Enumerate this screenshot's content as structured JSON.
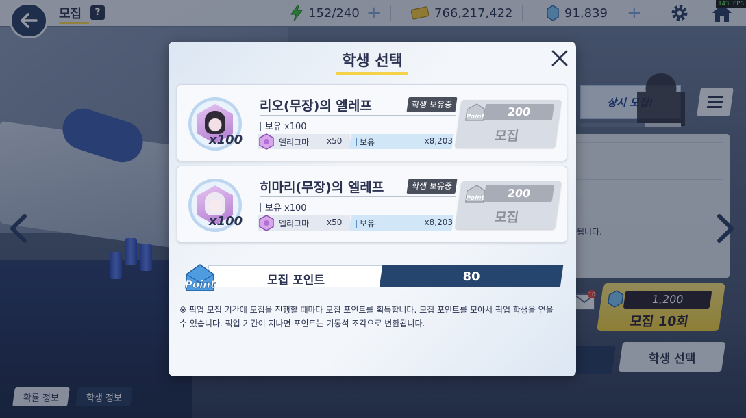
{
  "topbar": {
    "title": "모집",
    "help_label": "?",
    "ap": "152/240",
    "credits": "766,217,422",
    "pyroxene": "91,839",
    "fps": "143 FPS"
  },
  "right_panel": {
    "banner_text": "상시 모집!",
    "note_text": "됩니다.",
    "recruit10_cost": "1,200",
    "recruit10_label": "모집 10회",
    "mail_badge": "10",
    "student_select_label": "학생 선택"
  },
  "bottom_tabs": {
    "rates_label": "확률 정보",
    "student_info_label": "학생 정보"
  },
  "modal": {
    "title": "학생 선택",
    "cards": [
      {
        "name": "리오(무장)의 엘레프",
        "badge": "학생 보유중",
        "portrait_qty": "x100",
        "owned_count": "보유 x100",
        "eleph_name": "엘리그마",
        "eleph_cost": "x50",
        "eleph_owned_label": "보유",
        "eleph_owned_value": "x8,203",
        "point_cost": "200",
        "recruit_label": "모집"
      },
      {
        "name": "히마리(무장)의 엘레프",
        "badge": "학생 보유중",
        "portrait_qty": "x100",
        "owned_count": "보유 x100",
        "eleph_name": "엘리그마",
        "eleph_cost": "x50",
        "eleph_owned_label": "보유",
        "eleph_owned_value": "x8,203",
        "point_cost": "200",
        "recruit_label": "모집"
      }
    ],
    "points_label": "모집 포인트",
    "points_value": "80",
    "point_icon_text": "Point",
    "note": "※ 픽업 모집 기간에 모집을 진행할 때마다 모집 포인트를 획득합니다. 모집 포인트를 모아서 픽업 학생을 얻을 수 있습니다. 픽업 기간이 지나면 포인트는 기동석 조각으로 변환됩니다."
  },
  "colors": {
    "accent_yellow": "#f4d34a",
    "navy": "#25456f",
    "text_dark": "#2b3350"
  }
}
